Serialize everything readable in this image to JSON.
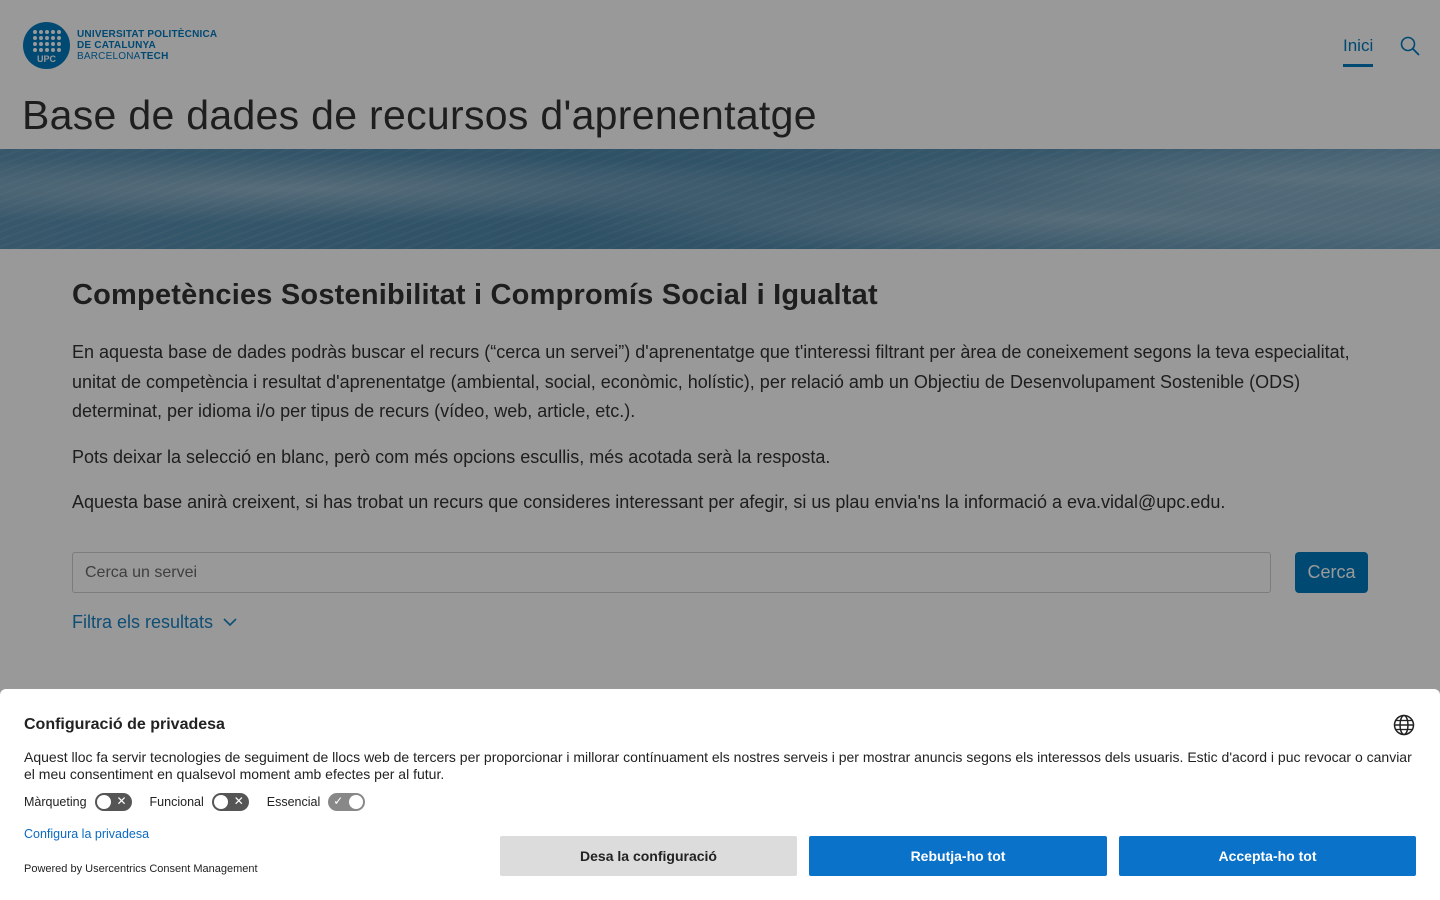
{
  "header": {
    "logo_lines": [
      "UNIVERSITAT POLITÈCNICA",
      "DE CATALUNYA",
      "BARCELONA",
      "TECH"
    ],
    "logo_mark": "UPC",
    "nav_inici": "Inici",
    "search_icon": "search-icon"
  },
  "page_title": "Base de dades de recursos d'aprenentatge",
  "main": {
    "section_title": "Competències Sostenibilitat i Compromís Social i Igualtat",
    "p1": "En aquesta base de dades podràs buscar el recurs (“cerca un servei”) d'aprenentatge que t'interessi filtrant per àrea de coneixement segons la teva especialitat, unitat de competència i resultat d'aprenentatge (ambiental, social, econòmic, holístic), per relació amb un Objectiu de Desenvolupament Sostenible (ODS) determinat, per idioma i/o per tipus de recurs (vídeo, web, article, etc.).",
    "p2": "Pots deixar la selecció en blanc, però com més opcions escullis, més acotada serà la resposta.",
    "p3": "Aquesta base anirà creixent, si has trobat un recurs que consideres interessant per afegir, si us plau envia'ns la informació a eva.vidal@upc.edu.",
    "search_placeholder": "Cerca un servei",
    "search_button": "Cerca",
    "filter_label": "Filtra els resultats"
  },
  "consent": {
    "title": "Configuració de privadesa",
    "text": "Aquest lloc fa servir tecnologies de seguiment de llocs web de tercers per proporcionar i millorar contínuament els nostres serveis i per mostrar anuncis segons els interessos dels usuaris. Estic d'acord i puc revocar o canviar el meu consentiment en qualsevol moment amb efectes per al futur.",
    "toggles": [
      {
        "label": "Màrqueting",
        "state": false
      },
      {
        "label": "Funcional",
        "state": false
      },
      {
        "label": "Essencial",
        "state": true
      }
    ],
    "configure_link": "Configura la privadesa",
    "powered_by": "Powered by Usercentrics Consent Management",
    "save_button": "Desa la configuració",
    "reject_button": "Rebutja-ho tot",
    "accept_button": "Accepta-ho tot"
  },
  "colors": {
    "brand": "#007bc0",
    "consent_button": "#0a72c9",
    "overlay": "rgba(0,0,0,0.4)"
  }
}
